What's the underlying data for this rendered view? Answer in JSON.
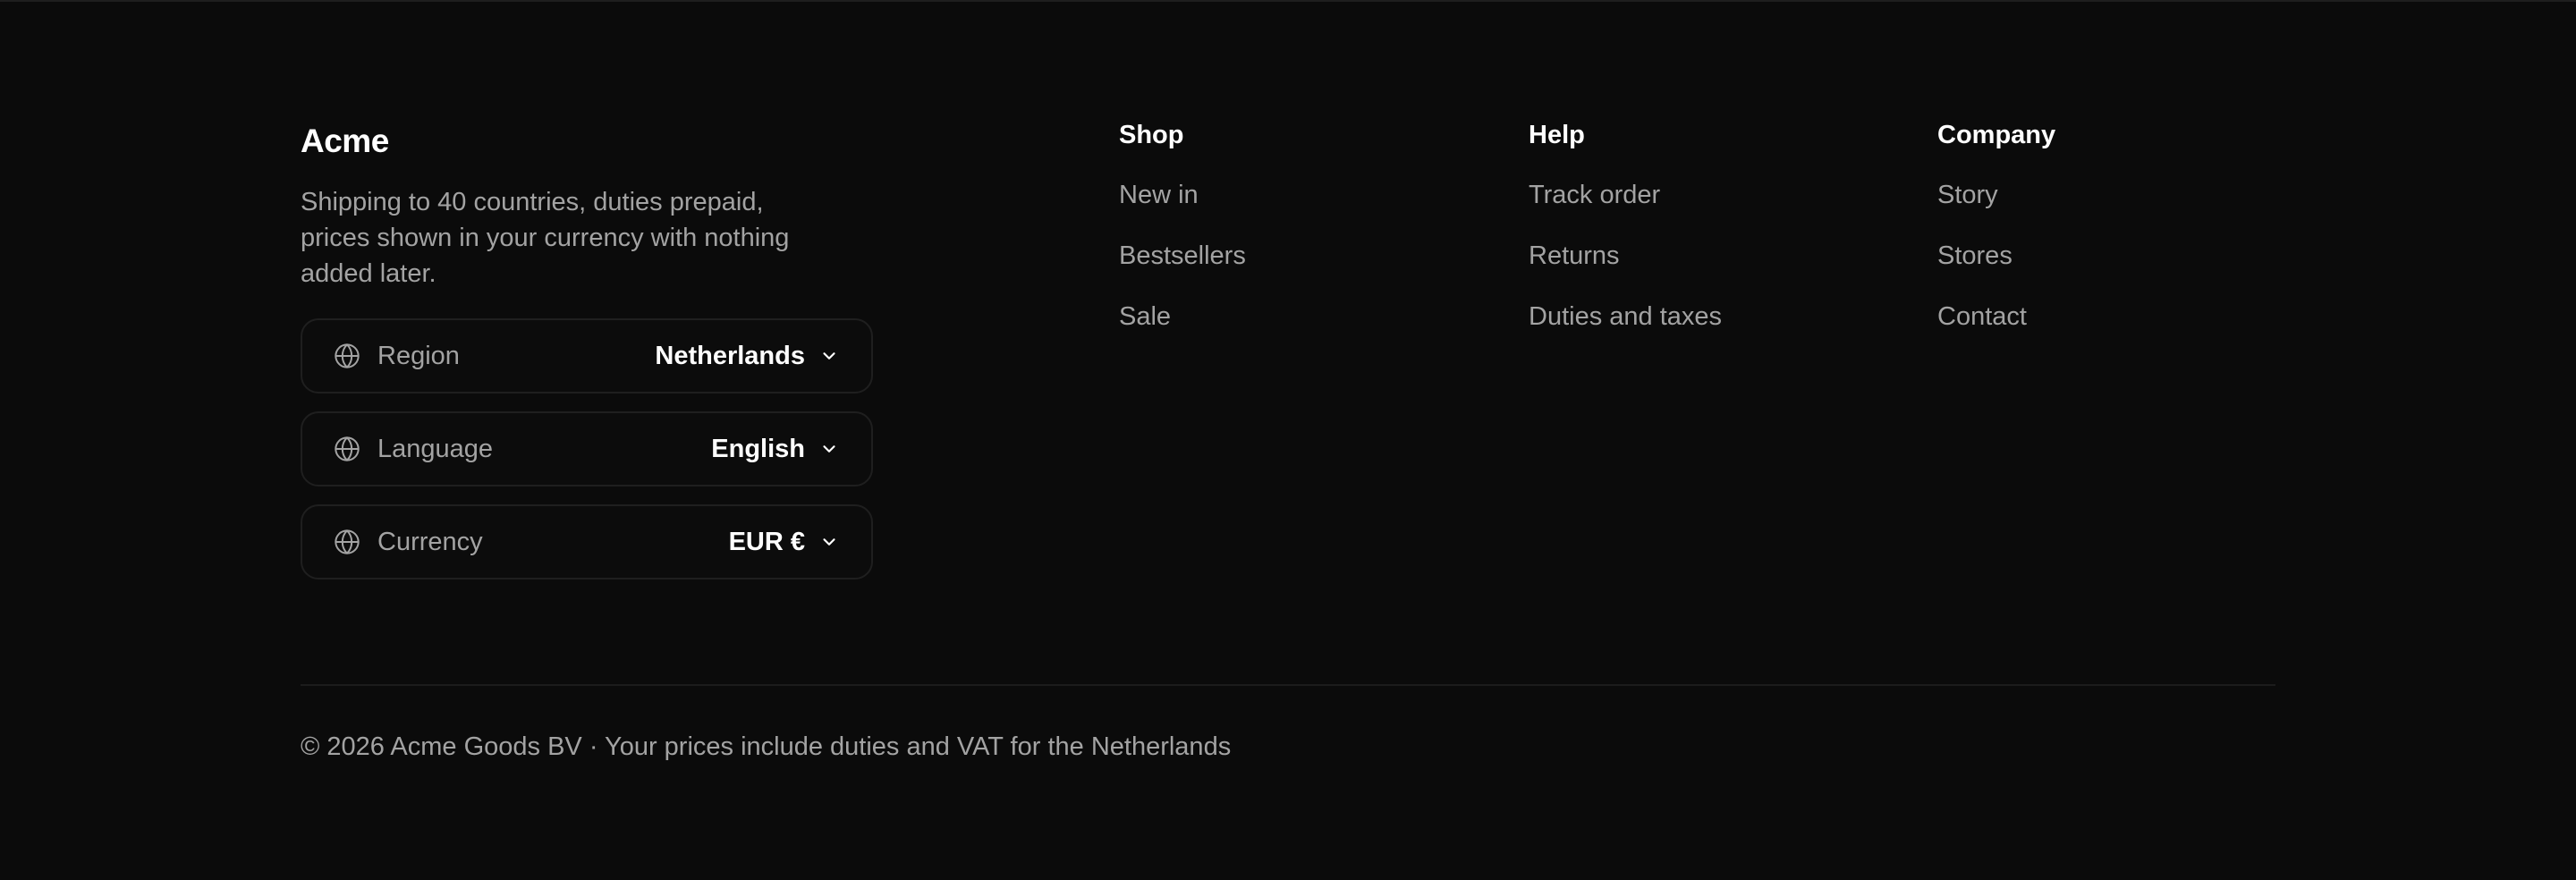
{
  "brand": {
    "name": "Acme",
    "tagline": "Shipping to 40 countries, duties prepaid, prices shown in your currency with nothing added later."
  },
  "selectors": [
    {
      "label": "Region",
      "value": "Netherlands",
      "icon": "globe-icon"
    },
    {
      "label": "Language",
      "value": "English",
      "icon": "globe-icon"
    },
    {
      "label": "Currency",
      "value": "EUR €",
      "icon": "globe-icon"
    }
  ],
  "columns": {
    "shop": {
      "title": "Shop",
      "links": [
        "New in",
        "Bestsellers",
        "Sale"
      ]
    },
    "help": {
      "title": "Help",
      "links": [
        "Track order",
        "Returns",
        "Duties and taxes"
      ]
    },
    "company": {
      "title": "Company",
      "links": [
        "Story",
        "Stores",
        "Contact"
      ]
    }
  },
  "copyright": "© 2026 Acme Goods BV · Your prices include duties and VAT for the Netherlands",
  "colors": {
    "background": "#0b0b0b",
    "text_primary": "#ffffff",
    "text_muted": "#a3a3a3",
    "border": "#1f1f1f"
  }
}
